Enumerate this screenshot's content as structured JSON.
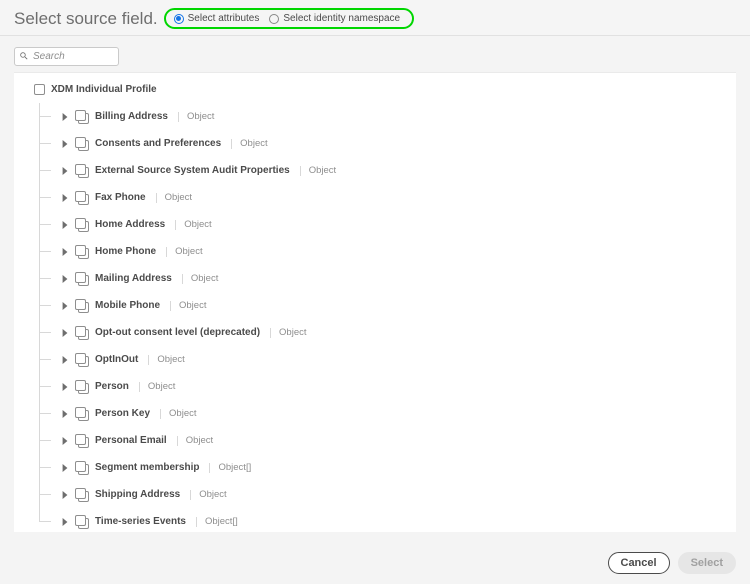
{
  "header": {
    "title": "Select source field.",
    "radio": {
      "attributes_label": "Select attributes",
      "identity_label": "Select identity namespace",
      "selected": "attributes"
    }
  },
  "search": {
    "placeholder": "Search"
  },
  "tree": {
    "root_label": "XDM Individual Profile",
    "items": [
      {
        "label": "Billing Address",
        "type": "Object"
      },
      {
        "label": "Consents and Preferences",
        "type": "Object"
      },
      {
        "label": "External Source System Audit Properties",
        "type": "Object"
      },
      {
        "label": "Fax Phone",
        "type": "Object"
      },
      {
        "label": "Home Address",
        "type": "Object"
      },
      {
        "label": "Home Phone",
        "type": "Object"
      },
      {
        "label": "Mailing Address",
        "type": "Object"
      },
      {
        "label": "Mobile Phone",
        "type": "Object"
      },
      {
        "label": "Opt-out consent level (deprecated)",
        "type": "Object"
      },
      {
        "label": "OptInOut",
        "type": "Object"
      },
      {
        "label": "Person",
        "type": "Object"
      },
      {
        "label": "Person Key",
        "type": "Object"
      },
      {
        "label": "Personal Email",
        "type": "Object"
      },
      {
        "label": "Segment membership",
        "type": "Object[]"
      },
      {
        "label": "Shipping Address",
        "type": "Object"
      },
      {
        "label": "Time-series Events",
        "type": "Object[]"
      }
    ]
  },
  "footer": {
    "cancel_label": "Cancel",
    "select_label": "Select",
    "select_enabled": false
  }
}
